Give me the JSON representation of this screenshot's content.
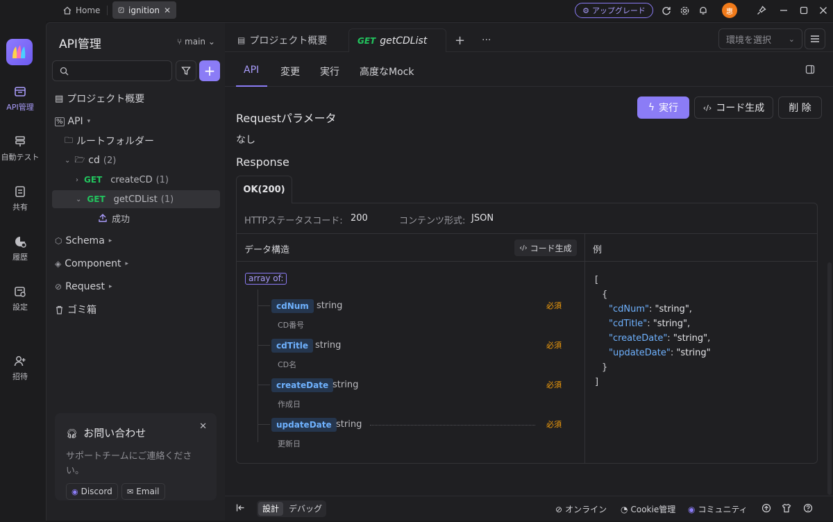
{
  "titlebar": {
    "home_label": "Home",
    "tab_label": "ignition",
    "upgrade_label": "アップグレード",
    "avatar_initial": "惠"
  },
  "rail": {
    "items": [
      {
        "label": "API管理",
        "icon": "api-icon"
      },
      {
        "label": "自動テスト",
        "icon": "test-icon"
      },
      {
        "label": "共有",
        "icon": "share-icon"
      },
      {
        "label": "履歴",
        "icon": "history-icon"
      },
      {
        "label": "設定",
        "icon": "settings-icon"
      },
      {
        "label": "招待",
        "icon": "invite-icon"
      }
    ]
  },
  "sidebar": {
    "title": "API管理",
    "branch": "main",
    "tree": {
      "overview": "プロジェクト概要",
      "api": "API",
      "root_folder": "ルートフォルダー",
      "cd_folder": "cd",
      "cd_count": "(2)",
      "method_get": "GET",
      "create_cd": "createCD",
      "create_cd_count": "(1)",
      "get_cd_list": "getCDList",
      "get_cd_list_count": "(1)",
      "success": "成功",
      "schema": "Schema",
      "component": "Component",
      "request": "Request",
      "trash": "ゴミ箱"
    },
    "help": {
      "title": "お問い合わせ",
      "text": "サポートチームにご連絡ください。",
      "discord": "Discord",
      "email": "Email"
    }
  },
  "main": {
    "tabs": {
      "overview": "プロジェクト概要",
      "method": "GET",
      "endpoint": "getCDList"
    },
    "env_placeholder": "環境を選択",
    "subtabs": [
      "API",
      "変更",
      "実行",
      "高度なMock"
    ],
    "buttons": {
      "run": "実行",
      "codegen": "コード生成",
      "delete": "削 除"
    },
    "request_params_label": "Requestパラメータ",
    "request_params_value": "なし",
    "response_label": "Response",
    "response_tab": "OK(200)",
    "http_status_key": "HTTPステータスコード:",
    "http_status_value": "200",
    "content_type_key": "コンテンツ形式:",
    "content_type_value": "JSON",
    "data_structure_label": "データ構造",
    "codegen_small": "コード生成",
    "example_label": "例",
    "array_of": "array of:",
    "fields": [
      {
        "name": "cdNum",
        "type": "string",
        "desc": "CD番号",
        "req": "必須"
      },
      {
        "name": "cdTitle",
        "type": "string",
        "desc": "CD名",
        "req": "必須"
      },
      {
        "name": "createDate",
        "type": "string",
        "desc": "作成日",
        "req": "必須"
      },
      {
        "name": "updateDate",
        "type": "string",
        "desc": "更新日",
        "req": "必須"
      }
    ],
    "example_json": {
      "open_bracket": "[",
      "open_brace": "{",
      "lines": [
        {
          "key": "\"cdNum\"",
          "value": "\"string\","
        },
        {
          "key": "\"cdTitle\"",
          "value": "\"string\","
        },
        {
          "key": "\"createDate\"",
          "value": "\"string\","
        },
        {
          "key": "\"updateDate\"",
          "value": "\"string\""
        }
      ],
      "close_brace": "}",
      "close_bracket": "]"
    }
  },
  "bottombar": {
    "design": "設計",
    "debug": "デバッグ",
    "online": "オンライン",
    "cookie": "Cookie管理",
    "community": "コミュニティ"
  },
  "colors": {
    "accent": "#8b7cf6",
    "get_method": "#22c55e",
    "required": "#f59e0b",
    "field_name": "#6fb2ff"
  }
}
